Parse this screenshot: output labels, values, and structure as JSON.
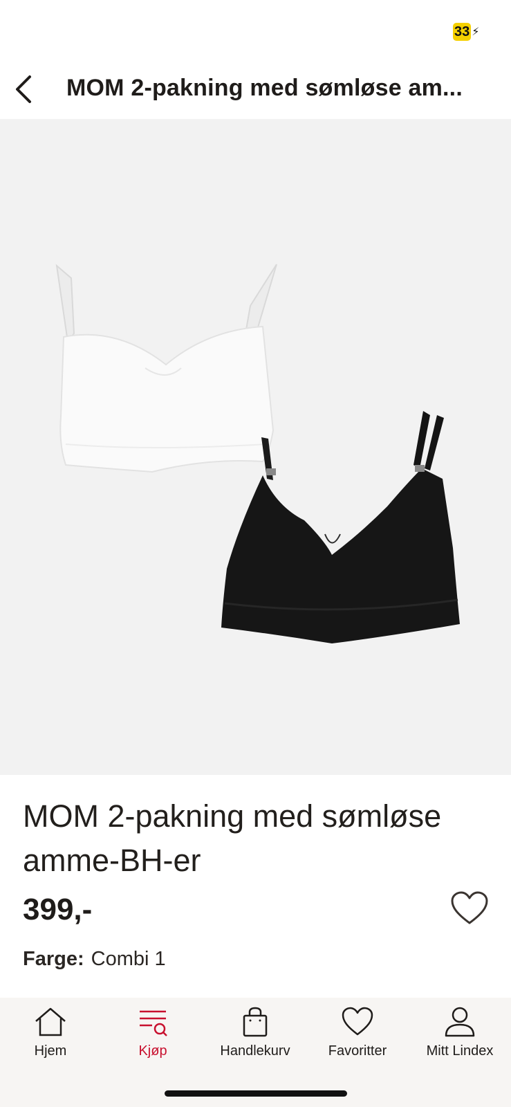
{
  "status_bar": {
    "battery_level": "33",
    "charging_icon": "bolt-icon",
    "battery_color": "#f5d000"
  },
  "header": {
    "back_icon": "chevron-left-icon",
    "title": "MOM 2-pakning med sømløse am..."
  },
  "gallery": {
    "dot_count": 3,
    "active_index": 0,
    "background": "#f2f2f2"
  },
  "product": {
    "name": "MOM 2-pakning med sømløse amme-BH-er",
    "price": "399,-",
    "favorite_icon": "heart-outline-icon",
    "color_label": "Farge:",
    "color_value": "Combi 1"
  },
  "bottom_nav": {
    "active_color": "#c8102e",
    "items": [
      {
        "label": "Hjem",
        "icon": "home-icon"
      },
      {
        "label": "Kjøp",
        "icon": "shop-search-icon",
        "active": true
      },
      {
        "label": "Handlekurv",
        "icon": "shopping-bag-icon"
      },
      {
        "label": "Favoritter",
        "icon": "heart-icon"
      },
      {
        "label": "Mitt Lindex",
        "icon": "user-icon"
      }
    ]
  }
}
